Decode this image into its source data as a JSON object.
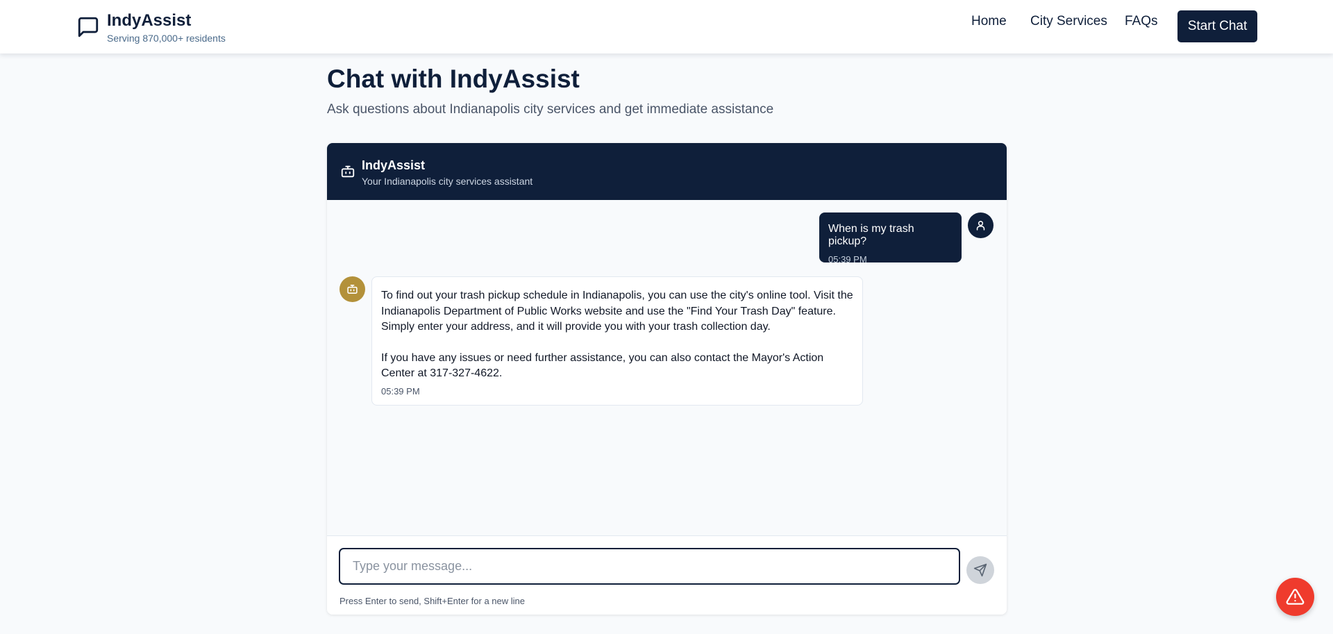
{
  "header": {
    "brand_name": "IndyAssist",
    "brand_sub": "Serving 870,000+ residents",
    "nav": [
      {
        "label": "Home"
      },
      {
        "label": "City Services"
      },
      {
        "label": "FAQs"
      }
    ],
    "cta_label": "Start Chat"
  },
  "page": {
    "title": "Chat with IndyAssist",
    "subtitle": "Ask questions about Indianapolis city services and get immediate assistance"
  },
  "chat": {
    "header_title": "IndyAssist",
    "header_sub": "Your Indianapolis city services assistant",
    "messages": [
      {
        "from": "user",
        "text": "When is my trash pickup?",
        "time": "05:39 PM"
      },
      {
        "from": "bot",
        "paragraphs": [
          "To find out your trash pickup schedule in Indianapolis, you can use the city's online tool. Visit the Indianapolis Department of Public Works website and use the \"Find Your Trash Day\" feature. Simply enter your address, and it will provide you with your trash collection day.",
          "If you have any issues or need further assistance, you can also contact the Mayor's Action Center at 317-327-4622."
        ],
        "time": "05:39 PM"
      }
    ],
    "input_placeholder": "Type your message...",
    "input_value": "",
    "hint": "Press Enter to send, Shift+Enter for a new line"
  },
  "icons": {
    "brand": "message-square-icon",
    "bot": "bot-icon",
    "user": "user-icon",
    "send": "send-icon",
    "alert": "alert-triangle-icon"
  },
  "colors": {
    "navy": "#0f1f3a",
    "gold": "#b3913a",
    "alert": "#ef3b2d",
    "background": "#f8fafc"
  }
}
